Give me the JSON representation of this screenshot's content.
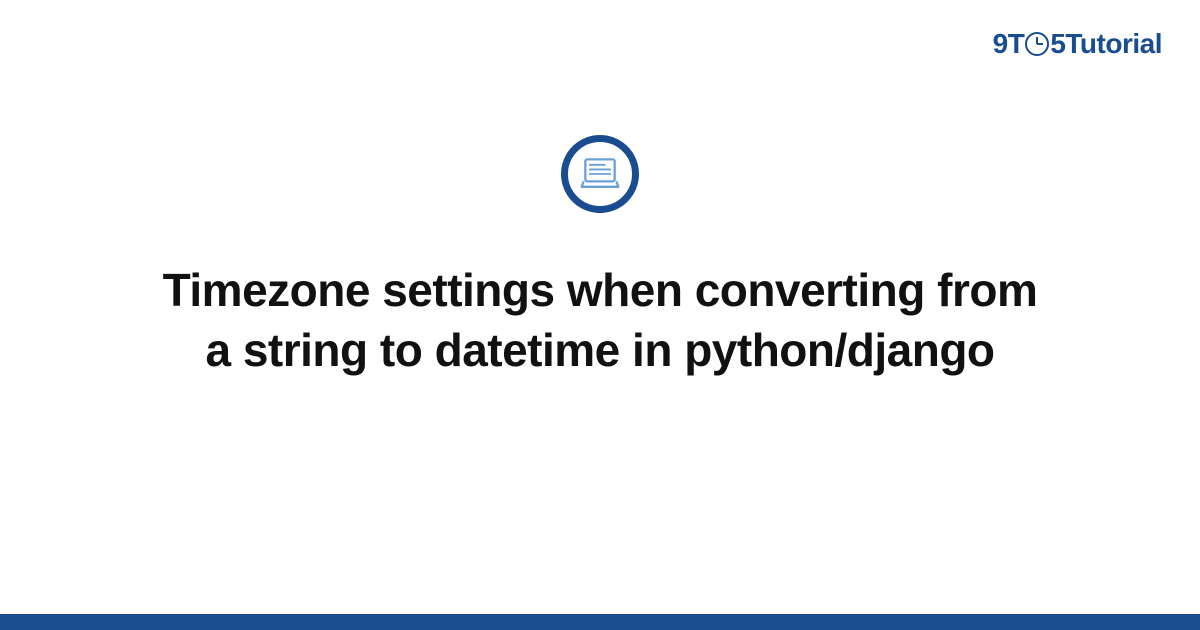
{
  "logo": {
    "prefix": "9T",
    "suffix": "5",
    "tutorial": "Tutorial"
  },
  "title": "Timezone settings when converting from a string to datetime in python/django",
  "colors": {
    "brand": "#1a4d8f",
    "iconStroke": "#6b9fd8"
  }
}
